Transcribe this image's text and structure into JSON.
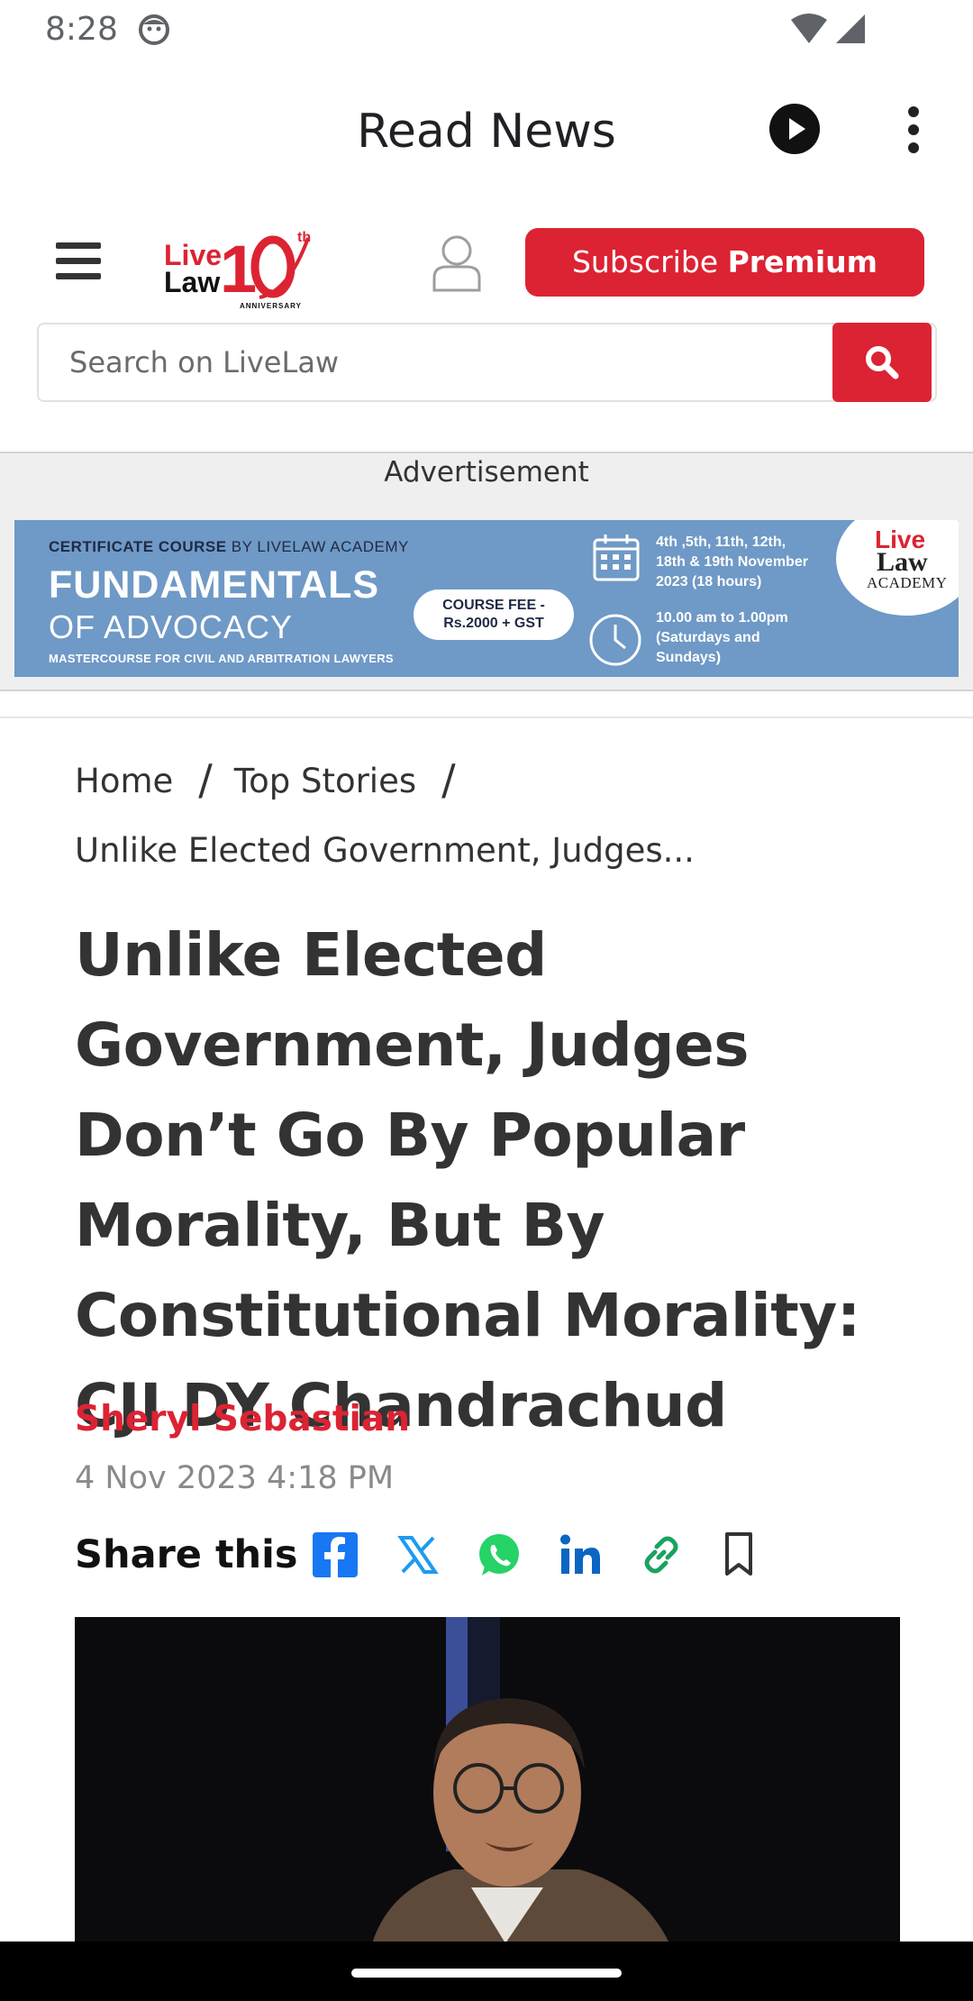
{
  "status_bar": {
    "time": "8:28"
  },
  "app_bar": {
    "title": "Read News"
  },
  "site_header": {
    "subscribe_text": "Subscribe ",
    "subscribe_bold": "Premium",
    "logo_text": "Live Law 10th Anniversary"
  },
  "search": {
    "placeholder": "Search on LiveLaw"
  },
  "ad": {
    "label": "Advertisement",
    "cert_bold": "CERTIFICATE COURSE",
    "cert_rest": " BY LIVELAW ACADEMY",
    "title_line1": "FUNDAMENTALS",
    "title_line2": "OF ADVOCACY",
    "subtitle": "MASTERCOURSE FOR CIVIL AND ARBITRATION LAWYERS",
    "fee_line1": "COURSE FEE -",
    "fee_line2": "Rs.2000 + GST",
    "dates_line1": "4th ,5th, 11th, 12th,",
    "dates_line2": "18th & 19th November",
    "dates_line3": "2023 (18 hours)",
    "times_line1": "10.00 am to 1.00pm",
    "times_line2": "(Saturdays and",
    "times_line3": "Sundays)",
    "logo_live": "Live",
    "logo_law": "Law",
    "logo_academy": "ACADEMY"
  },
  "breadcrumb": {
    "home": "Home",
    "section": "Top Stories",
    "current": "Unlike Elected Government, Judges..."
  },
  "article": {
    "headline": "Unlike Elected Government, Judges Don’t Go By Popular Morality, But By Constitutional Morality: CJI DY Chandrachud",
    "author": "Sheryl Sebastian",
    "date": "4 Nov 2023 4:18 PM",
    "share_label": "Share this"
  },
  "colors": {
    "brand_red": "#dc2333",
    "facebook": "#1877f2",
    "x": "#1d9bf0",
    "whatsapp": "#25d366",
    "linkedin": "#0a66c2",
    "link": "#1aa260"
  },
  "icons": [
    "menu-icon",
    "user-icon",
    "search-icon",
    "play-icon",
    "more-vert-icon",
    "facebook-icon",
    "x-icon",
    "whatsapp-icon",
    "linkedin-icon",
    "link-icon",
    "bookmark-icon"
  ]
}
